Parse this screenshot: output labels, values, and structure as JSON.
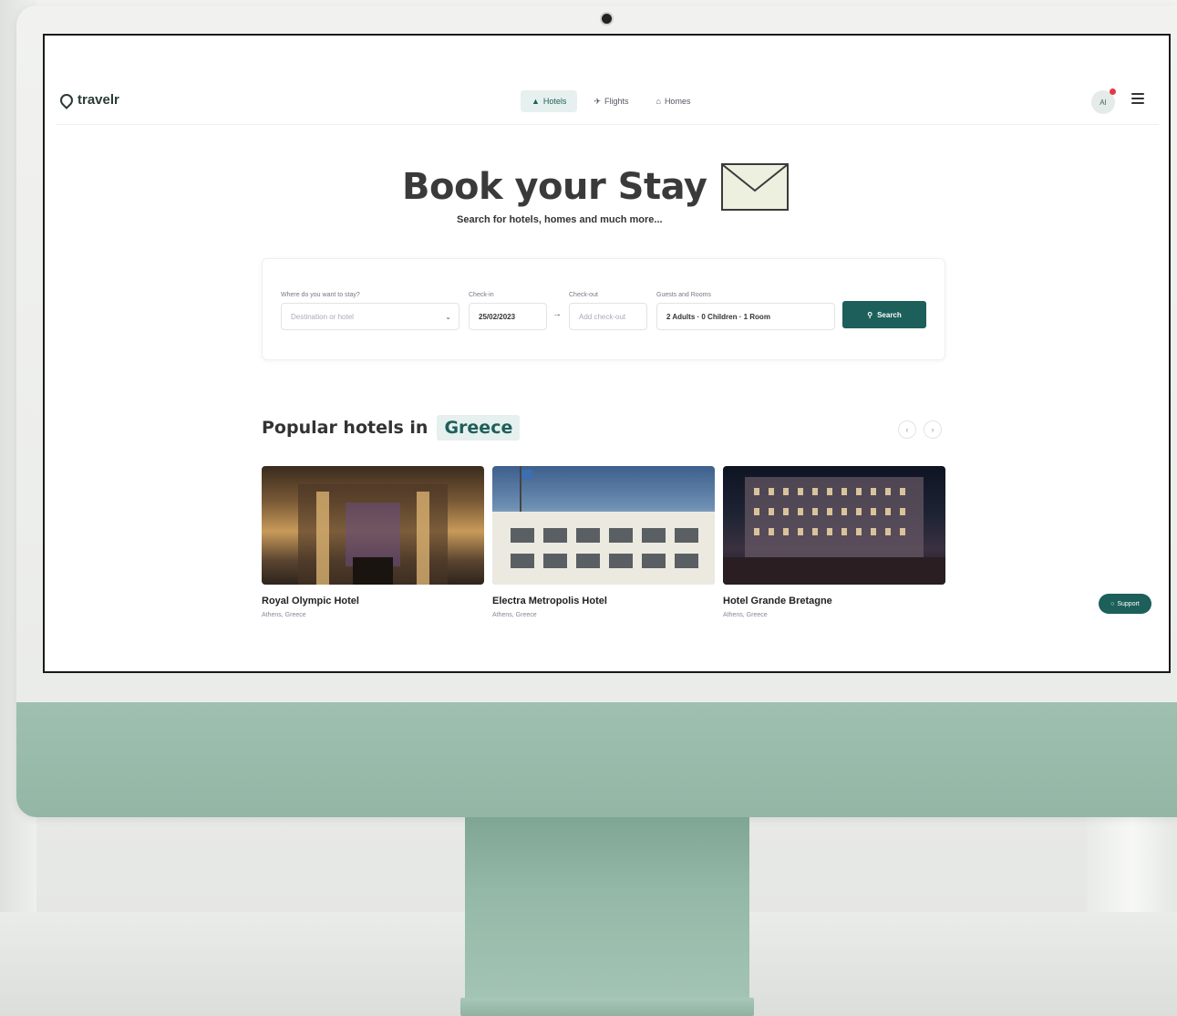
{
  "brand": {
    "name": "travelr"
  },
  "nav": {
    "tabs": [
      {
        "label": "Hotels",
        "icon": "bed-icon",
        "active": true
      },
      {
        "label": "Flights",
        "icon": "plane-icon",
        "active": false
      },
      {
        "label": "Homes",
        "icon": "home-icon",
        "active": false
      }
    ],
    "avatar_initials": "AI"
  },
  "hero": {
    "title": "Book your Stay",
    "subtitle": "Search for hotels, homes and much more..."
  },
  "search": {
    "destination_label": "Where do you want to stay?",
    "destination_placeholder": "Destination or hotel",
    "checkin_label": "Check-in",
    "checkin_value": "25/02/2023",
    "checkout_label": "Check-out",
    "checkout_placeholder": "Add check-out",
    "guests_label": "Guests and Rooms",
    "guests_value": "2 Adults · 0 Children · 1 Room",
    "button_label": "Search"
  },
  "popular": {
    "title": "Popular hotels in",
    "country": "Greece",
    "hotels": [
      {
        "name": "Royal Olympic Hotel",
        "location": "Athens, Greece"
      },
      {
        "name": "Electra Metropolis Hotel",
        "location": "Athens, Greece"
      },
      {
        "name": "Hotel Grande Bretagne",
        "location": "Athens, Greece"
      }
    ]
  },
  "support": {
    "label": "Support"
  },
  "colors": {
    "accent": "#1d5f5a",
    "accent_light": "#e6f0ee",
    "notification": "#e53945"
  }
}
